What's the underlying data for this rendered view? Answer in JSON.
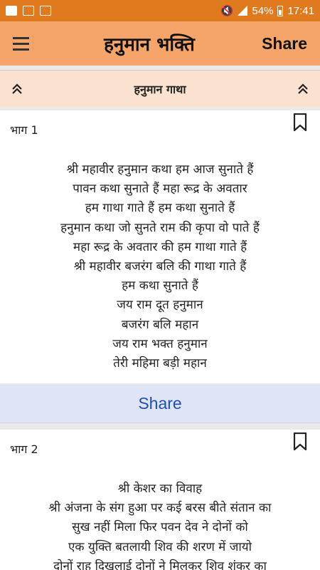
{
  "status_bar": {
    "battery": "54%",
    "time": "17:41"
  },
  "app_bar": {
    "title": "हनुमान भक्ति",
    "share_label": "Share"
  },
  "section": {
    "title": "हनुमान गाथा"
  },
  "parts": [
    {
      "label": "भाग 1",
      "lines": [
        "श्री महावीर हनुमान कथा हम आज सुनाते हैं",
        "पावन कथा सुनाते हैं महा रूद्र के अवतार",
        "हम गाथा गाते हैं हम कथा सुनाते हैं",
        "हनुमान कथा जो सुनते राम की कृपा वो पाते हैं",
        "महा रूद्र के अवतार की हम गाथा गाते हैं",
        "श्री महावीर बजरंग बलि की गाथा गाते हैं",
        "हम कथा सुनाते हैं",
        "जय राम दूत हनुमान",
        "बजरंग बलि महान",
        "जय राम भक्त हनुमान",
        "तेरी महिमा बड़ी महान"
      ],
      "share_label": "Share"
    },
    {
      "label": "भाग 2",
      "lines": [
        "श्री केशर का विवाह",
        "श्री अंजना के संग हुआ पर कई बरस बीते संतान का",
        "सुख नहीं मिला फिर पवन देव ने दोनों को",
        "एक युक्ति बतलायी शिव की शरण में जायो",
        "दोनों राह दिखलाई दोनों ने मिलकर शिव शंकर का"
      ]
    }
  ]
}
